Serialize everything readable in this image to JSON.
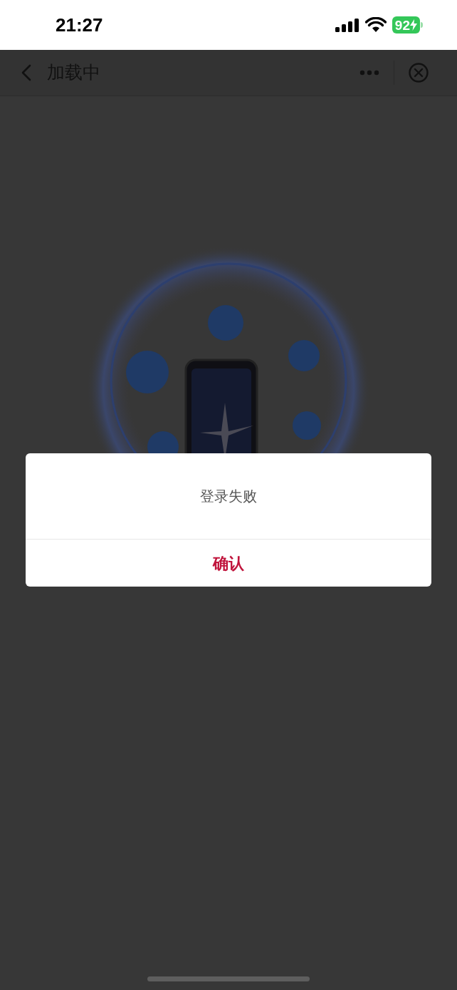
{
  "status_bar": {
    "time": "21:27",
    "battery": "92"
  },
  "nav_bar": {
    "title": "加载中"
  },
  "dialog": {
    "message": "登录失败",
    "button": "确认"
  }
}
